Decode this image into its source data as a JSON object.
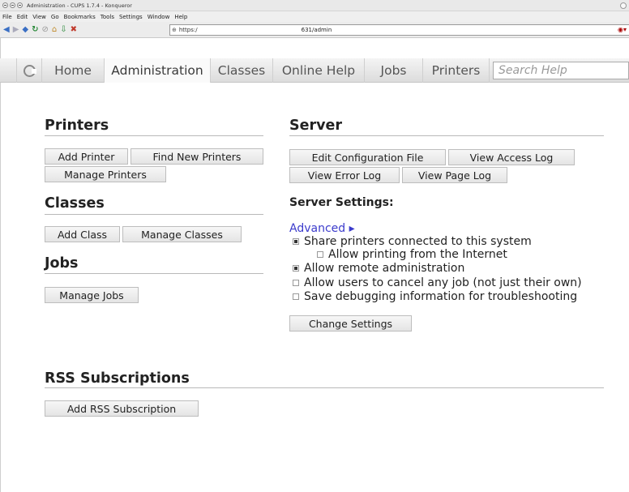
{
  "window": {
    "title": "Administration - CUPS 1.7.4 - Konqueror"
  },
  "menubar": [
    "File",
    "Edit",
    "View",
    "Go",
    "Bookmarks",
    "Tools",
    "Settings",
    "Window",
    "Help"
  ],
  "toolbar": {
    "url_scheme": "https:/",
    "url_path": "631/admin"
  },
  "nav": {
    "tabs": [
      "Home",
      "Administration",
      "Classes",
      "Online Help",
      "Jobs",
      "Printers"
    ],
    "active_tab": "Administration",
    "search_placeholder": "Search Help"
  },
  "printers": {
    "title": "Printers",
    "add_printer": "Add Printer",
    "find_new_printers": "Find New Printers",
    "manage_printers": "Manage Printers"
  },
  "classes": {
    "title": "Classes",
    "add_class": "Add Class",
    "manage_classes": "Manage Classes"
  },
  "jobs": {
    "title": "Jobs",
    "manage_jobs": "Manage Jobs"
  },
  "server": {
    "title": "Server",
    "edit_configuration_file": "Edit Configuration File",
    "view_access_log": "View Access Log",
    "view_error_log": "View Error Log",
    "view_page_log": "View Page Log",
    "settings_heading": "Server Settings:",
    "advanced_link": "Advanced ▸",
    "options": [
      {
        "label": "Share printers connected to this system",
        "checked": true
      },
      {
        "label": "Allow printing from the Internet",
        "checked": false
      },
      {
        "label": "Allow remote administration",
        "checked": true
      },
      {
        "label": "Allow users to cancel any job (not just their own)",
        "checked": false
      },
      {
        "label": "Save debugging information for troubleshooting",
        "checked": false
      }
    ],
    "change_settings": "Change Settings"
  },
  "rss": {
    "title": "RSS Subscriptions",
    "add_rss_subscription": "Add RSS Subscription"
  }
}
